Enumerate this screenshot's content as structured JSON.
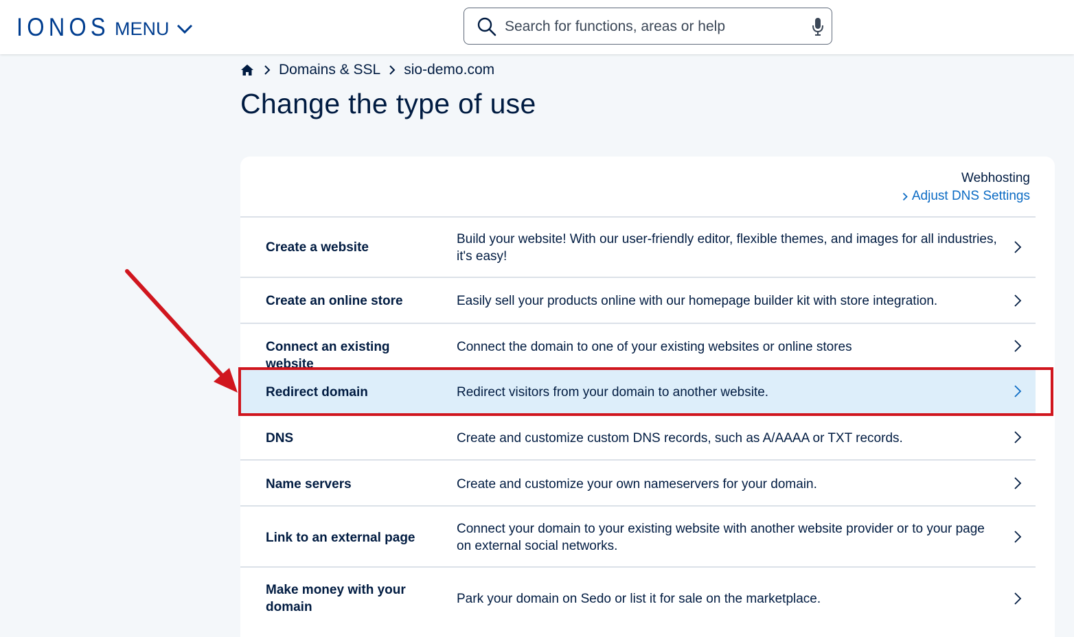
{
  "header": {
    "logo": "IONOS",
    "menu_label": "MENU",
    "search_placeholder": "Search for functions, areas or help"
  },
  "breadcrumb": {
    "items": [
      "Domains & SSL",
      "sio-demo.com"
    ]
  },
  "page_title": "Change the type of use",
  "card": {
    "current_type": "Webhosting",
    "dns_link": "Adjust DNS Settings"
  },
  "options": [
    {
      "title": "Create a website",
      "description": "Build your website! With our user-friendly editor, flexible themes, and images for all industries, it's easy!"
    },
    {
      "title": "Create an online store",
      "description": "Easily sell your products online with our homepage builder kit with store integration."
    },
    {
      "title": "Connect an existing website",
      "description": "Connect the domain to one of your existing websites or online stores"
    },
    {
      "title": "Redirect domain",
      "description": "Redirect visitors from your domain to another website.",
      "selected": true
    },
    {
      "title": "DNS",
      "description": "Create and customize custom DNS records, such as A/AAAA or TXT records."
    },
    {
      "title": "Name servers",
      "description": "Create and customize your own nameservers for your domain."
    },
    {
      "title": "Link to an external page",
      "description": "Connect your domain to your existing website with another website provider or to your page on external social networks."
    },
    {
      "title": "Make money with your domain",
      "description": "Park your domain on Sedo or list it for sale on the marketplace."
    }
  ],
  "colors": {
    "brand": "#003d8f",
    "link": "#0b6bc4",
    "selected_row": "#ddeefa",
    "annotation": "#d0161e"
  }
}
